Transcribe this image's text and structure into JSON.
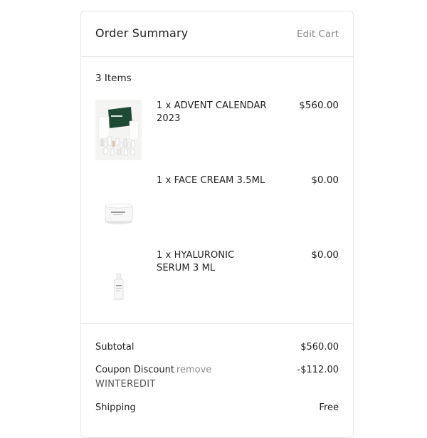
{
  "header": {
    "title": "Order Summary",
    "edit_label": "Edit Cart"
  },
  "items_count": "3 Items",
  "items": [
    {
      "name": "1 x ADVENT CALENDAR 2023",
      "price": "$560.00",
      "image": "advent-calendar-product-image"
    },
    {
      "name": "1 x FACE CREAM 3.5ML",
      "price": "$0.00",
      "image": "face-cream-jar-image"
    },
    {
      "name": "1 x HYALURONIC SERUM 3 ML",
      "price": "$0.00",
      "image": "serum-bottle-image"
    }
  ],
  "totals": {
    "subtotal_label": "Subtotal",
    "subtotal_value": "$560.00",
    "coupon_label": "Coupon Discount",
    "coupon_remove": "remove",
    "coupon_code": "WINTEREDIT",
    "coupon_value": "-$112.00",
    "shipping_label": "Shipping",
    "shipping_value": "Free"
  },
  "colors": {
    "border": "#e6e6e6",
    "muted_text": "#8a8a8a",
    "brand_green": "#1e4a35"
  }
}
